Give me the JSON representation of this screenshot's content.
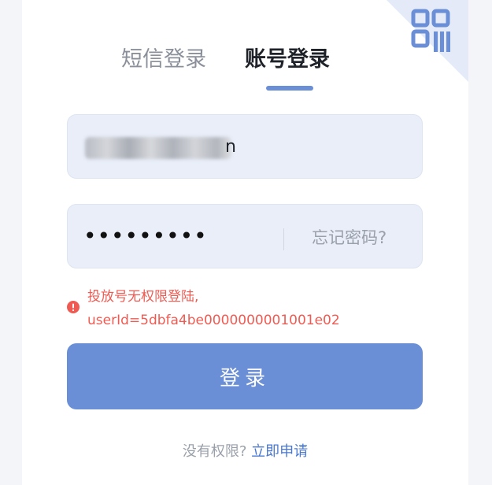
{
  "tabs": {
    "sms_label": "短信登录",
    "account_label": "账号登录",
    "active": "account"
  },
  "qr_toggle": {
    "icon": "qr-code-icon"
  },
  "username": {
    "visible_tail": "n"
  },
  "password": {
    "masked_value": "•••••••••",
    "forgot_label": "忘记密码?"
  },
  "error": {
    "icon": "error-icon",
    "line1": "投放号无权限登陆,",
    "line2": "userId=5dbfa4be0000000001001e02"
  },
  "login_button": {
    "label": "登录"
  },
  "footer": {
    "prompt": "没有权限?",
    "link_label": "立即申请"
  },
  "colors": {
    "accent": "#6a8fd6",
    "error": "#ef5b52",
    "link": "#4a78d0",
    "field_bg": "#e9eef9"
  }
}
